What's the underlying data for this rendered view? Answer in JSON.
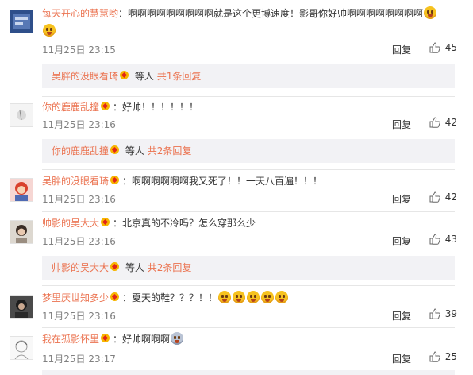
{
  "comments": [
    {
      "user": "每天开心的慧慧哟",
      "separator": "：",
      "content_line1": "啊啊啊啊啊啊啊啊啊就是这个更博速度！影哥你好帅啊啊啊啊啊啊啊啊",
      "date": "11月25日 23:15",
      "reply": "回复",
      "likes": "45",
      "sub": {
        "user": "吴胖的没眼看琦",
        "mid": "等人",
        "link": "共1条回复"
      }
    },
    {
      "user": "你的鹿鹿乱撞",
      "separator": "：",
      "content": "好帅！！！！！！",
      "date": "11月25日 23:16",
      "reply": "回复",
      "likes": "42",
      "sub": {
        "user": "你的鹿鹿乱撞",
        "mid": "等人",
        "link": "共2条回复"
      }
    },
    {
      "user": "吴胖的没眼看琦",
      "separator": "：",
      "content": "啊啊啊啊啊啊我又死了！！一天八百遍！！！",
      "date": "11月25日 23:16",
      "reply": "回复",
      "likes": "42"
    },
    {
      "user": "帅影的吴大大",
      "separator": "：",
      "content": "北京真的不冷吗？怎么穿那么少",
      "date": "11月25日 23:16",
      "reply": "回复",
      "likes": "43",
      "sub": {
        "user": "帅影的吴大大",
        "mid": "等人",
        "link": "共2条回复"
      }
    },
    {
      "user": "梦里厌世知多少",
      "separator": "：",
      "content": "夏天的鞋？？？！！",
      "date": "11月25日 23:16",
      "reply": "回复",
      "likes": "39"
    },
    {
      "user": "我在孤影怀里",
      "separator": "：",
      "content": "好帅啊啊啊",
      "date": "11月25日 23:17",
      "reply": "回复",
      "likes": "25"
    }
  ],
  "colors": {
    "username": "#eb7350",
    "date": "#808080",
    "subbox": "#f2f2f5"
  },
  "icons": [
    "user-avatar",
    "vip-badge-icon",
    "emoji-icon",
    "thumbs-up-icon"
  ]
}
